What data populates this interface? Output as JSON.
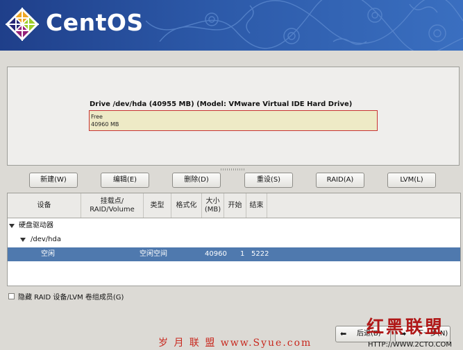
{
  "header": {
    "brand": "CentOS",
    "logo_icon": "centos-logo-icon",
    "banner_color": "#2c59a8"
  },
  "drive": {
    "title": "Drive /dev/hda (40955 MB) (Model: VMware Virtual IDE Hard Drive)",
    "segment_label": "Free",
    "segment_size": "40960 MB",
    "segment_border_color": "#c83232",
    "segment_fill_color": "#eeeac6"
  },
  "buttons": {
    "new": "新建(W)",
    "edit": "编辑(E)",
    "delete": "删除(D)",
    "reset": "重设(S)",
    "raid": "RAID(A)",
    "lvm": "LVM(L)"
  },
  "table": {
    "columns": [
      "设备",
      "挂载点/\nRAID/Volume",
      "类型",
      "格式化",
      "大小\n(MB)",
      "开始",
      "结束"
    ],
    "rows": [
      {
        "device": "硬盘驱动器",
        "expanded": true
      },
      {
        "device": "/dev/hda",
        "expanded": true
      },
      {
        "device": "空闲",
        "mount": "",
        "type": "空闲空间",
        "format": "",
        "size": "40960",
        "start": "1",
        "end": "5222",
        "selected": true
      }
    ],
    "selection_color": "#4f79ae"
  },
  "options": {
    "hide_raid_label": "隐藏 RAID 设备/LVM 卷组成员(G)",
    "hide_raid_checked": false
  },
  "nav": {
    "back_label": "后退(B)",
    "back_icon": "arrow-left-icon",
    "next_label": "下一步(N)",
    "next_icon": "arrow-right-icon"
  },
  "watermarks": {
    "left": "岁 月 联 盟  www.Syue.com",
    "right_title": "红黑联盟",
    "right_url": "HTTP://WWW.2CTO.COM"
  }
}
